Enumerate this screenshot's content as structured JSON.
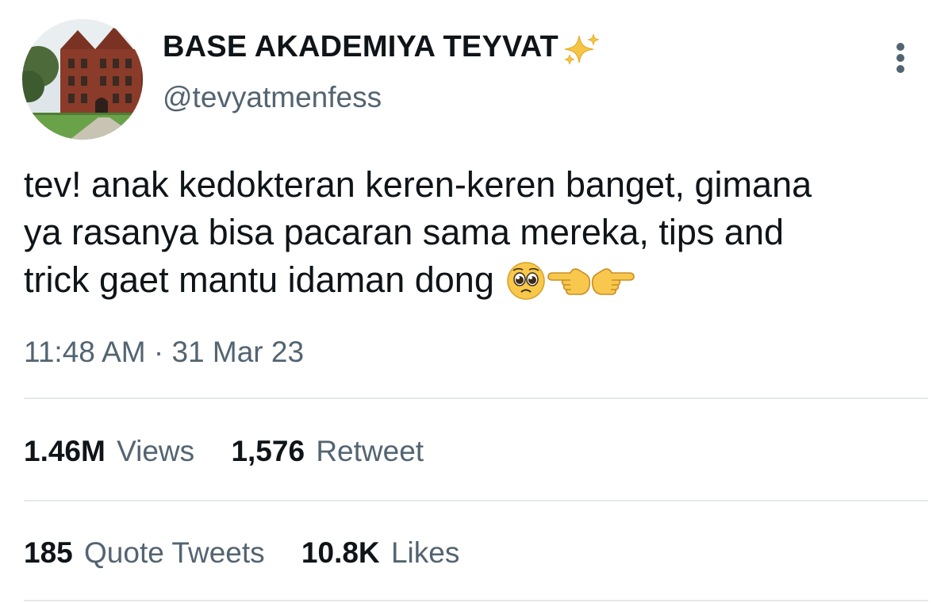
{
  "tweet": {
    "display_name": "BASE AKADEMIYA TEYVAT",
    "handle": "@tevyatmenfess",
    "text_lines": [
      "tev! anak kedokteran keren-keren banget, gimana",
      "ya rasanya bisa pacaran sama mereka, tips and",
      "trick gaet mantu idaman dong"
    ],
    "emojis": [
      "pleading-face-emoji",
      "backhand-index-pointing-left-emoji",
      "backhand-index-pointing-right-emoji"
    ],
    "timestamp": "11:48 AM · 31 Mar 23"
  },
  "stats": {
    "views_count": "1.46M",
    "views_label": "Views",
    "retweets_count": "1,576",
    "retweets_label": "Retweet",
    "quotes_count": "185",
    "quotes_label": "Quote Tweets",
    "likes_count": "10.8K",
    "likes_label": "Likes"
  },
  "icons": {
    "verified_decor": "sparkles-icon",
    "menu": "more-vertical-icon"
  },
  "colors": {
    "text_primary": "#0f1419",
    "text_secondary": "#536471",
    "divider": "#e4e8eb",
    "background": "#ffffff"
  }
}
